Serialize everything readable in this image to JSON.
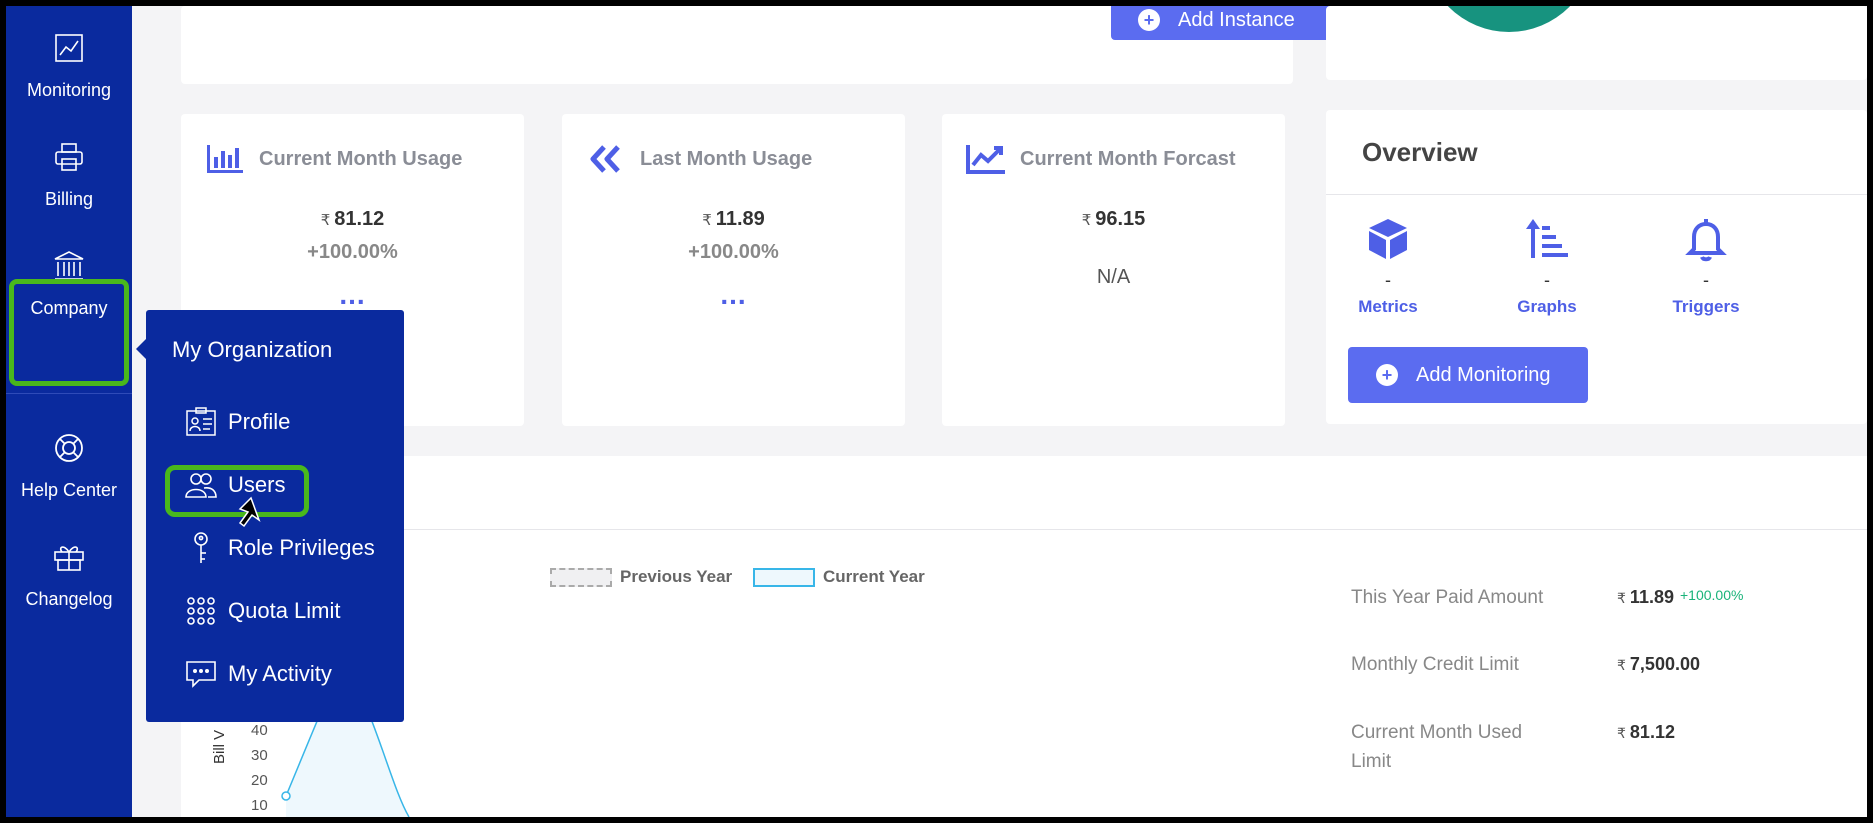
{
  "sidebar": {
    "items": [
      {
        "label": "Monitoring",
        "icon": "chart-line-icon"
      },
      {
        "label": "Billing",
        "icon": "printer-icon"
      },
      {
        "label": "Company",
        "icon": "bank-icon"
      },
      {
        "label": "Help Center",
        "icon": "lifebuoy-icon"
      },
      {
        "label": "Changelog",
        "icon": "gift-box-icon"
      }
    ]
  },
  "top": {
    "add_instance_label": "Add Instance"
  },
  "stats": [
    {
      "title": "Current Month Usage",
      "currency": "₹",
      "value": "81.12",
      "percent": "+100.00%",
      "more": "..."
    },
    {
      "title": "Last Month Usage",
      "currency": "₹",
      "value": "11.89",
      "percent": "+100.00%",
      "more": "..."
    },
    {
      "title": "Current Month Forcast",
      "currency": "₹",
      "value": "96.15",
      "note": "N/A"
    }
  ],
  "overview": {
    "title": "Overview",
    "items": [
      {
        "label": "Metrics",
        "value": "-",
        "icon": "cube-icon"
      },
      {
        "label": "Graphs",
        "value": "-",
        "icon": "sort-arrow-icon"
      },
      {
        "label": "Triggers",
        "value": "-",
        "icon": "bell-icon"
      }
    ],
    "add_monitoring_label": "Add Monitoring"
  },
  "chart": {
    "legend_previous": "Previous Year",
    "legend_current": "Current Year",
    "y_axis_title": "Bill V",
    "y_ticks": [
      "10",
      "20",
      "30",
      "40"
    ]
  },
  "chart_data": {
    "type": "area",
    "ylabel": "Bill V",
    "series": [
      {
        "name": "Previous Year",
        "values": []
      },
      {
        "name": "Current Year",
        "values": [
          11.89
        ]
      }
    ]
  },
  "billing": {
    "rows": [
      {
        "label": "This Year Paid Amount",
        "currency": "₹",
        "value": "11.89",
        "change": "+100.00%"
      },
      {
        "label": "Monthly Credit Limit",
        "currency": "₹",
        "value": "7,500.00"
      },
      {
        "label_line1": "Current Month Used",
        "label_line2": "Limit",
        "currency": "₹",
        "value": "81.12"
      }
    ]
  },
  "menu": {
    "title": "My Organization",
    "items": [
      {
        "label": "Profile",
        "icon": "id-card-icon"
      },
      {
        "label": "Users",
        "icon": "users-icon"
      },
      {
        "label": "Role Privileges",
        "icon": "key-icon"
      },
      {
        "label": "Quota Limit",
        "icon": "grid-dots-icon"
      },
      {
        "label": "My Activity",
        "icon": "chat-icon"
      }
    ]
  },
  "colors": {
    "sidebar": "#0a2a9e",
    "accent": "#5b6cf0",
    "highlight": "#49b81c",
    "positive": "#1ab37a"
  }
}
